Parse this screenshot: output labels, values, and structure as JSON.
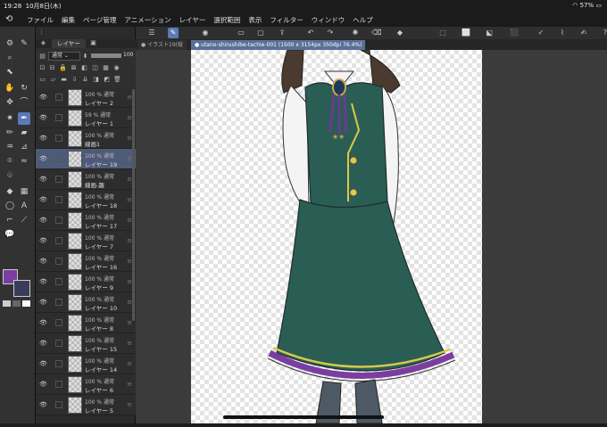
{
  "status": {
    "time": "19:28",
    "date": "10月8日(木)",
    "battery": "57%"
  },
  "menu": [
    "ファイル",
    "編集",
    "ページ管理",
    "アニメーション",
    "レイヤー",
    "選択範囲",
    "表示",
    "フィルター",
    "ウィンドウ",
    "ヘルプ"
  ],
  "layer_panel": {
    "tab": "レイヤー",
    "blend_mode": "通常",
    "opacity": "100"
  },
  "layers": [
    {
      "t1": "100 % 通常",
      "t2": "レイヤー 2"
    },
    {
      "t1": "59 % 通常",
      "t2": "レイヤー 1"
    },
    {
      "t1": "100 % 通常",
      "t2": "線画1"
    },
    {
      "t1": "100 % 通常",
      "t2": "レイヤー 19"
    },
    {
      "t1": "100 % 通常",
      "t2": "線画-趣"
    },
    {
      "t1": "100 % 通常",
      "t2": "レイヤー 18"
    },
    {
      "t1": "100 % 通常",
      "t2": "レイヤー 17"
    },
    {
      "t1": "100 % 通常",
      "t2": "レイヤー 7"
    },
    {
      "t1": "100 % 通常",
      "t2": "レイヤー 16"
    },
    {
      "t1": "100 % 通常",
      "t2": "レイヤー 9"
    },
    {
      "t1": "100 % 通常",
      "t2": "レイヤー 10"
    },
    {
      "t1": "100 % 通常",
      "t2": "レイヤー 8"
    },
    {
      "t1": "100 % 通常",
      "t2": "レイヤー 15"
    },
    {
      "t1": "100 % 通常",
      "t2": "レイヤー 14"
    },
    {
      "t1": "100 % 通常",
      "t2": "レイヤー 6"
    },
    {
      "t1": "100 % 通常",
      "t2": "レイヤー 5"
    }
  ],
  "tabs": {
    "inactive": "イラスト19(縦",
    "active": "utano-shirushibe-tachie-001 (1500 x 3154px 350dpi 76.4%)"
  },
  "colors": {
    "main": "#7b3ea0",
    "sub": "#3b3b5c",
    "accent": "#5a79b8",
    "dress": "#2a5e55",
    "frill": "#7b3ea0"
  }
}
